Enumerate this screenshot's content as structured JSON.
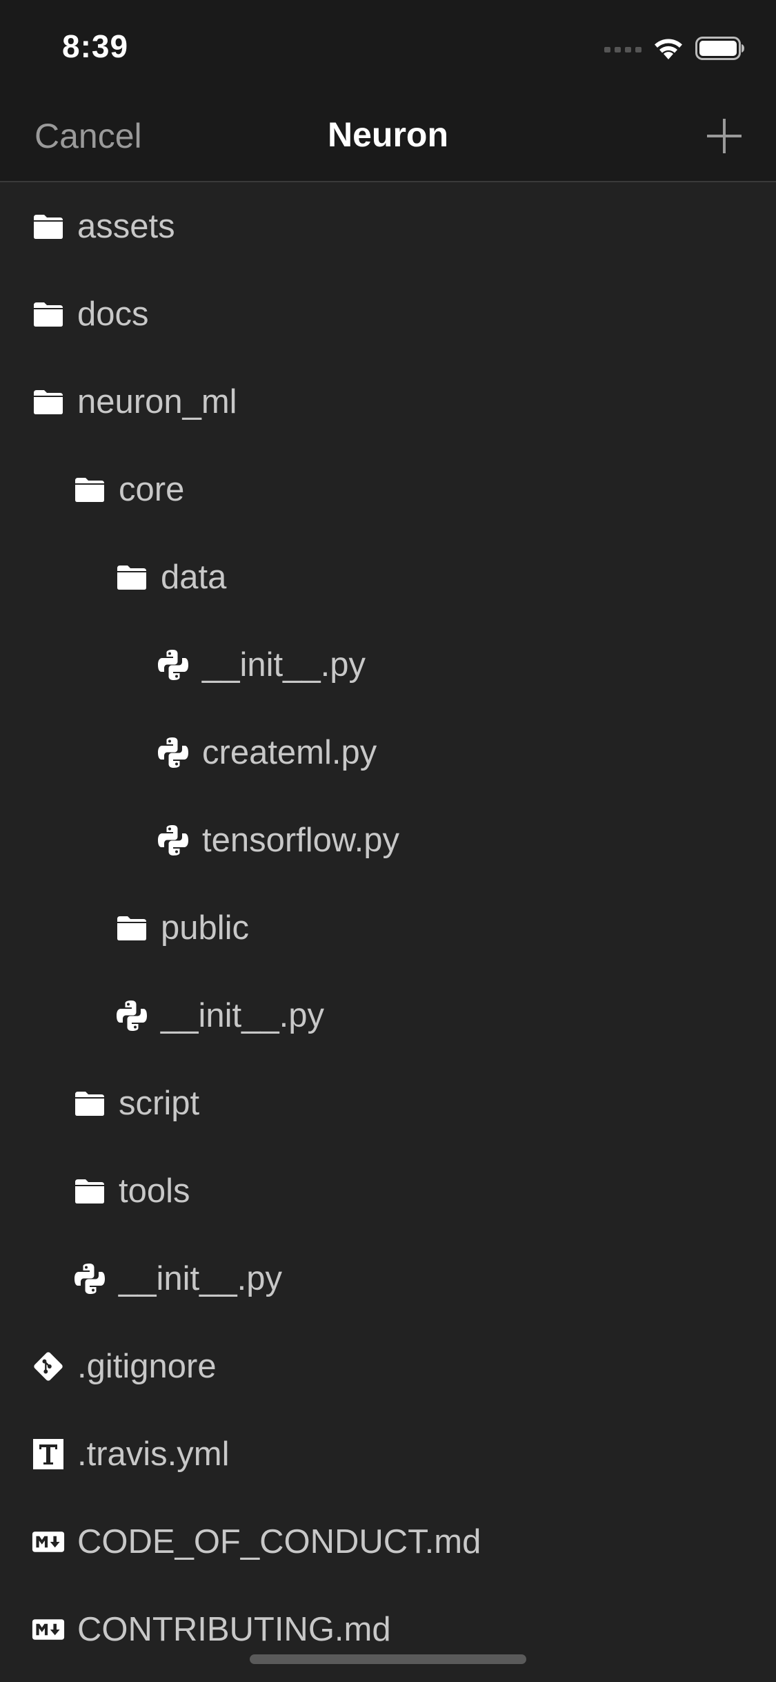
{
  "status_bar": {
    "time": "8:39"
  },
  "nav": {
    "cancel_label": "Cancel",
    "title": "Neuron",
    "add_icon": "plus-icon"
  },
  "files": [
    {
      "name": "assets",
      "type": "folder",
      "depth": 0
    },
    {
      "name": "docs",
      "type": "folder",
      "depth": 0
    },
    {
      "name": "neuron_ml",
      "type": "folder",
      "depth": 0
    },
    {
      "name": "core",
      "type": "folder",
      "depth": 1
    },
    {
      "name": "data",
      "type": "folder",
      "depth": 2
    },
    {
      "name": "__init__.py",
      "type": "python",
      "depth": 3
    },
    {
      "name": "createml.py",
      "type": "python",
      "depth": 3
    },
    {
      "name": "tensorflow.py",
      "type": "python",
      "depth": 3
    },
    {
      "name": "public",
      "type": "folder",
      "depth": 2
    },
    {
      "name": "__init__.py",
      "type": "python",
      "depth": 2
    },
    {
      "name": "script",
      "type": "folder",
      "depth": 1
    },
    {
      "name": "tools",
      "type": "folder",
      "depth": 1
    },
    {
      "name": "__init__.py",
      "type": "python",
      "depth": 1
    },
    {
      "name": ".gitignore",
      "type": "git",
      "depth": 0
    },
    {
      "name": ".travis.yml",
      "type": "text",
      "depth": 0
    },
    {
      "name": "CODE_OF_CONDUCT.md",
      "type": "markdown",
      "depth": 0
    },
    {
      "name": "CONTRIBUTING.md",
      "type": "markdown",
      "depth": 0
    }
  ],
  "colors": {
    "background": "#222222",
    "bar_background": "#1a1a1a",
    "label_text": "#c8c8c8",
    "title_text": "#ffffff",
    "cancel_text": "#9a9a9a",
    "icon_fill": "#ffffff"
  }
}
